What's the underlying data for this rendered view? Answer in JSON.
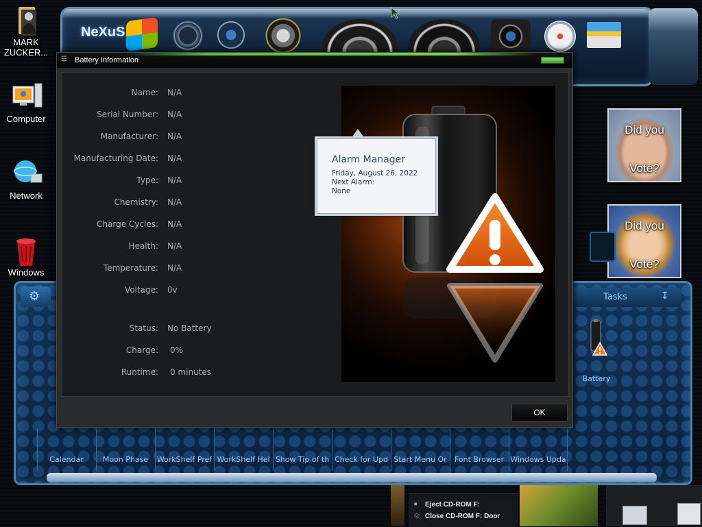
{
  "desktop": {
    "icons": [
      {
        "label": "MARK ZUCKER..."
      },
      {
        "label": "Computer"
      },
      {
        "label": "Network"
      },
      {
        "label": "Windows"
      }
    ]
  },
  "dock": {
    "logo_text": "NeXuS"
  },
  "widgets": {
    "vote_top": "Did you",
    "vote_bottom": "Vote?"
  },
  "workshelf": {
    "tasks_label": "Tasks",
    "battery_label": "Battery",
    "items": [
      "Calendar",
      "Moon Phase",
      "WorkShelf Pref",
      "WorkShelf Hel",
      "Show Tip of th",
      "Check for Upd",
      "Start Menu Or",
      "Font Browser",
      "Windows Upda"
    ]
  },
  "battery_window": {
    "title": "Battery Information",
    "fields": [
      {
        "label": "Name:",
        "value": "N/A"
      },
      {
        "label": "Serial Number:",
        "value": "N/A"
      },
      {
        "label": "Manufacturer:",
        "value": "N/A"
      },
      {
        "label": "Manufacturing Date:",
        "value": "N/A"
      },
      {
        "label": "Type:",
        "value": "N/A"
      },
      {
        "label": "Chemistry:",
        "value": "N/A"
      },
      {
        "label": "Charge Cycles:",
        "value": "N/A"
      },
      {
        "label": "Health:",
        "value": "N/A"
      },
      {
        "label": "Temperature:",
        "value": "N/A"
      },
      {
        "label": "Voltage:",
        "value": "0v"
      }
    ],
    "status": [
      {
        "label": "Status:",
        "value": "No Battery"
      },
      {
        "label": "Charge:",
        "value": "0%"
      },
      {
        "label": "Runtime:",
        "value": "0 minutes"
      }
    ],
    "ok_label": "OK"
  },
  "alarm_tooltip": {
    "title": "Alarm Manager",
    "date": "Friday, August 26, 2022",
    "next_alarm_label": "Next Alarm:",
    "next_alarm_value": "None"
  },
  "context_menu": {
    "eject": "Eject CD-ROM F:",
    "close": "Close CD-ROM F: Door"
  },
  "colors": {
    "accent_green": "#6cc83f",
    "shelf_blue": "#0d2a4a",
    "shelf_text": "#8fd0ff"
  }
}
